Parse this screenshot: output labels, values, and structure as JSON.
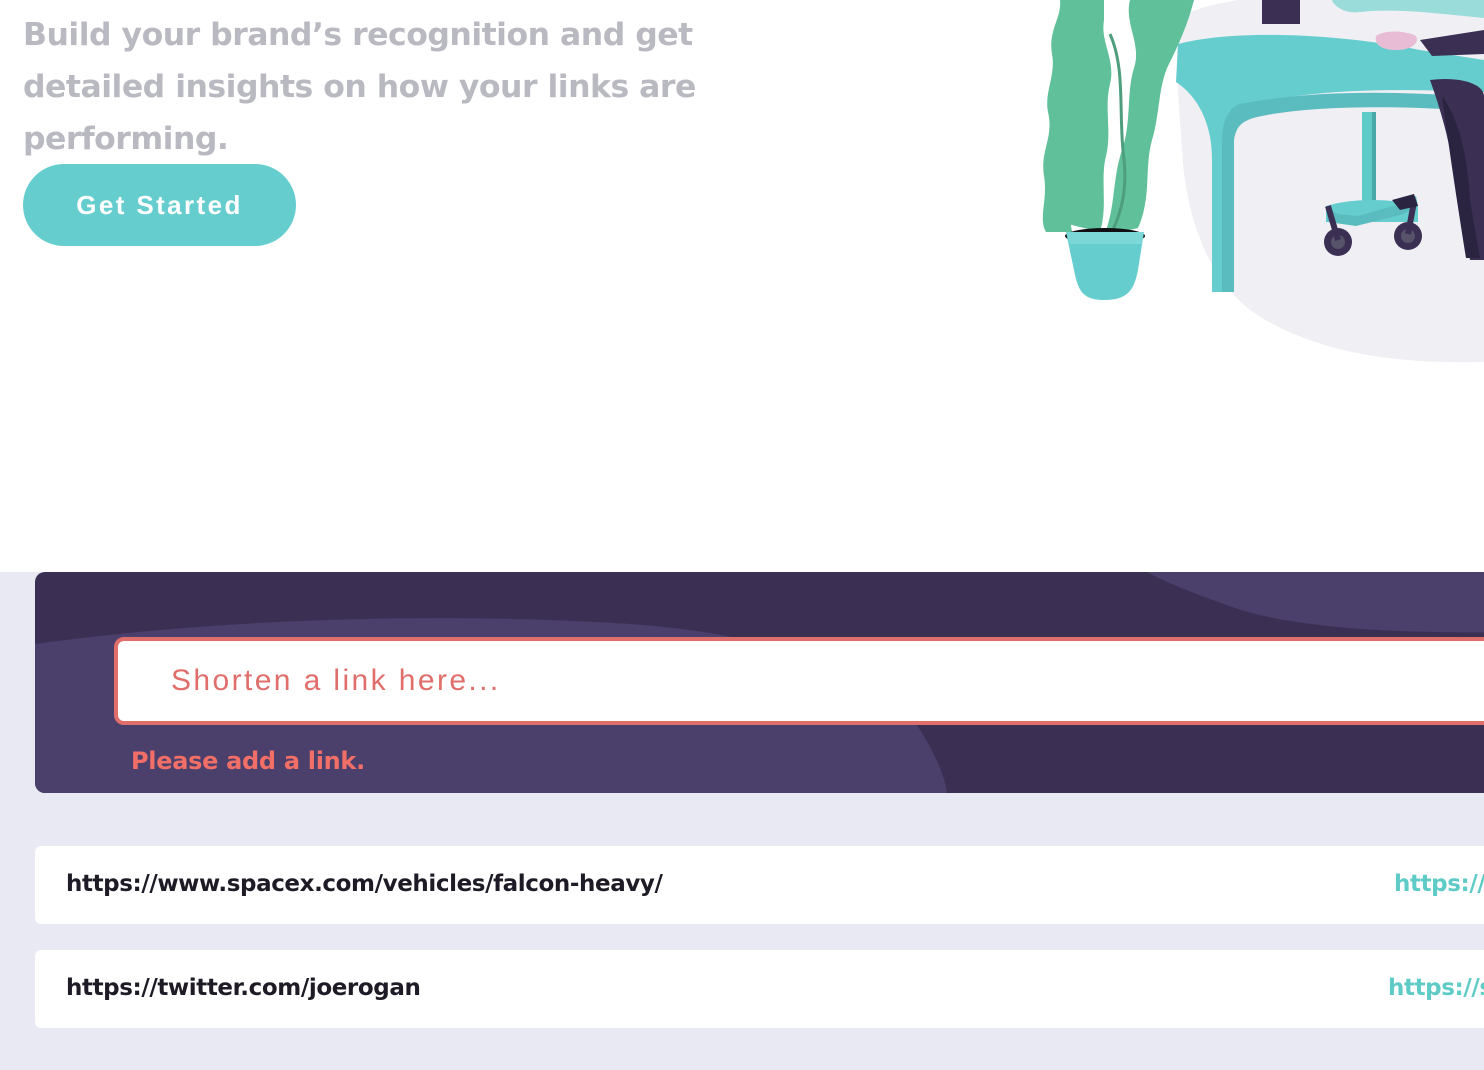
{
  "hero": {
    "description": "Build your brand’s recognition and get detailed insights on how your links are performing.",
    "cta_label": "Get Started"
  },
  "shorten": {
    "placeholder": "Shorten a link here...",
    "error": "Please add a link."
  },
  "results": [
    {
      "original": "https://www.spacex.com/vehicles/falcon-heavy/",
      "short": "https://"
    },
    {
      "original": "https://twitter.com/joerogan",
      "short": "https://s"
    }
  ],
  "colors": {
    "brand_cyan": "#66cdcf",
    "dark_violet": "#3b3054",
    "error_red": "#f26f68",
    "section_bg": "#e8e9f2"
  }
}
